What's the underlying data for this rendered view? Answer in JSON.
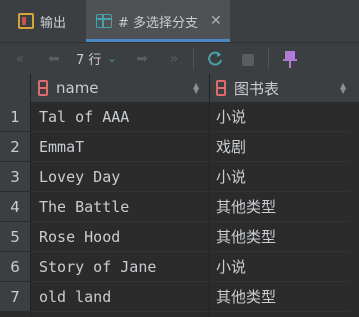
{
  "tabs": [
    {
      "label": "输出",
      "icon": "output-icon"
    },
    {
      "label": "# 多选择分支",
      "icon": "table-grid-icon",
      "close": "✕"
    }
  ],
  "toolbar": {
    "first": "«",
    "prev": "⬅",
    "rows_label": "7 行",
    "rows_chevron": "⌄",
    "next": "➡",
    "last": "»"
  },
  "columns": [
    {
      "name": "name",
      "icon": "column-icon"
    },
    {
      "name": "图书表",
      "icon": "column-icon"
    }
  ],
  "rows": [
    {
      "num": "1",
      "name": "Tal of AAA",
      "category": "小说"
    },
    {
      "num": "2",
      "name": "EmmaT",
      "category": "戏剧"
    },
    {
      "num": "3",
      "name": "Lovey Day",
      "category": "小说"
    },
    {
      "num": "4",
      "name": "The Battle",
      "category": "其他类型"
    },
    {
      "num": "5",
      "name": "Rose Hood",
      "category": "其他类型"
    },
    {
      "num": "6",
      "name": "Story of Jane",
      "category": "小说"
    },
    {
      "num": "7",
      "name": "old land",
      "category": "其他类型"
    }
  ],
  "colors": {
    "accent": "#4a88c7",
    "refresh": "#4aa0a8",
    "pin": "#b07cd8",
    "column_icon": "#e06c6c"
  }
}
